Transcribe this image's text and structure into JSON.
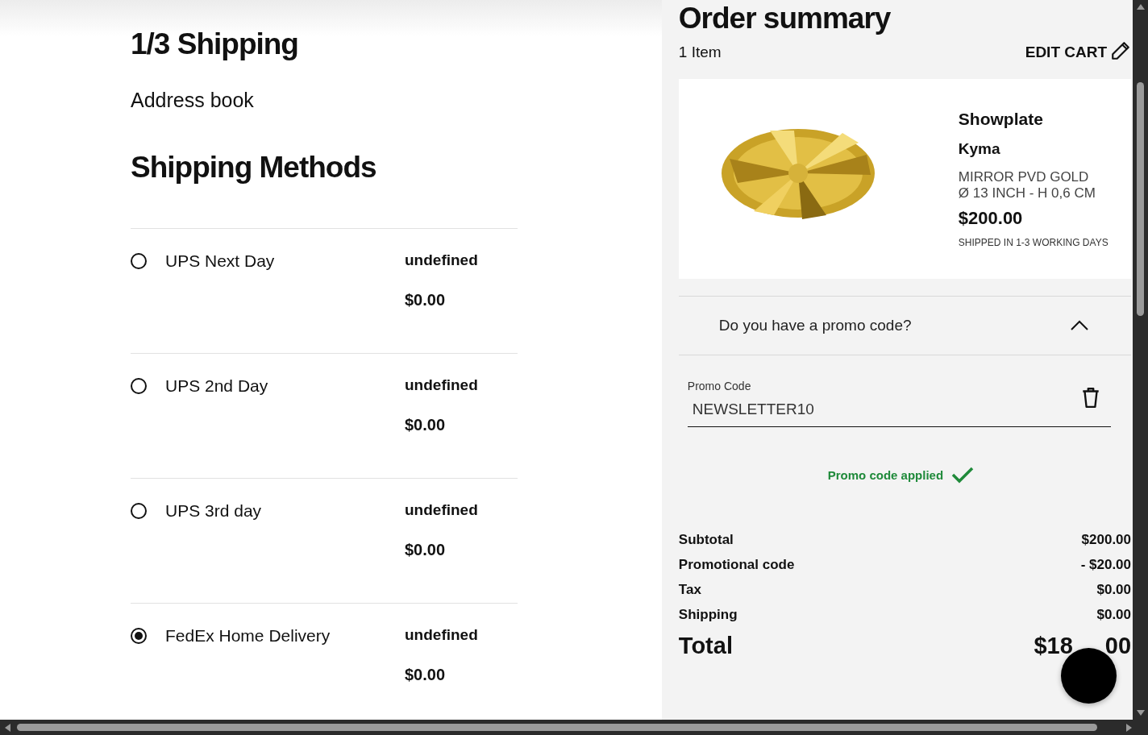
{
  "checkout": {
    "step_title": "1/3 Shipping",
    "address_book": "Address book",
    "methods_title": "Shipping Methods",
    "methods": [
      {
        "name": "UPS Next Day",
        "eta": "undefined",
        "price": "$0.00",
        "selected": false
      },
      {
        "name": "UPS 2nd Day",
        "eta": "undefined",
        "price": "$0.00",
        "selected": false
      },
      {
        "name": "UPS 3rd day",
        "eta": "undefined",
        "price": "$0.00",
        "selected": false
      },
      {
        "name": "FedEx Home Delivery",
        "eta": "undefined",
        "price": "$0.00",
        "selected": true
      }
    ]
  },
  "summary": {
    "title": "Order summary",
    "item_count": "1  Item",
    "edit_cart": "EDIT CART",
    "product": {
      "name": "Showplate",
      "collection": "Kyma",
      "finish": "MIRROR PVD GOLD",
      "size": "Ø 13 INCH - H 0,6 CM",
      "price": "$200.00",
      "shipping_note": "SHIPPED IN 1-3 WORKING DAYS"
    },
    "promo": {
      "question": "Do you have a promo code?",
      "expanded": true,
      "field_label": "Promo Code",
      "value": "NEWSLETTER10",
      "status": "Promo code applied"
    },
    "totals": [
      {
        "label": "Subtotal",
        "value": "$200.00"
      },
      {
        "label": "Promotional code",
        "value": "- $20.00"
      },
      {
        "label": "Tax",
        "value": "$0.00"
      },
      {
        "label": "Shipping",
        "value": "$0.00"
      }
    ],
    "total": {
      "label": "Total",
      "value_parts": [
        "$18",
        "00"
      ]
    }
  }
}
